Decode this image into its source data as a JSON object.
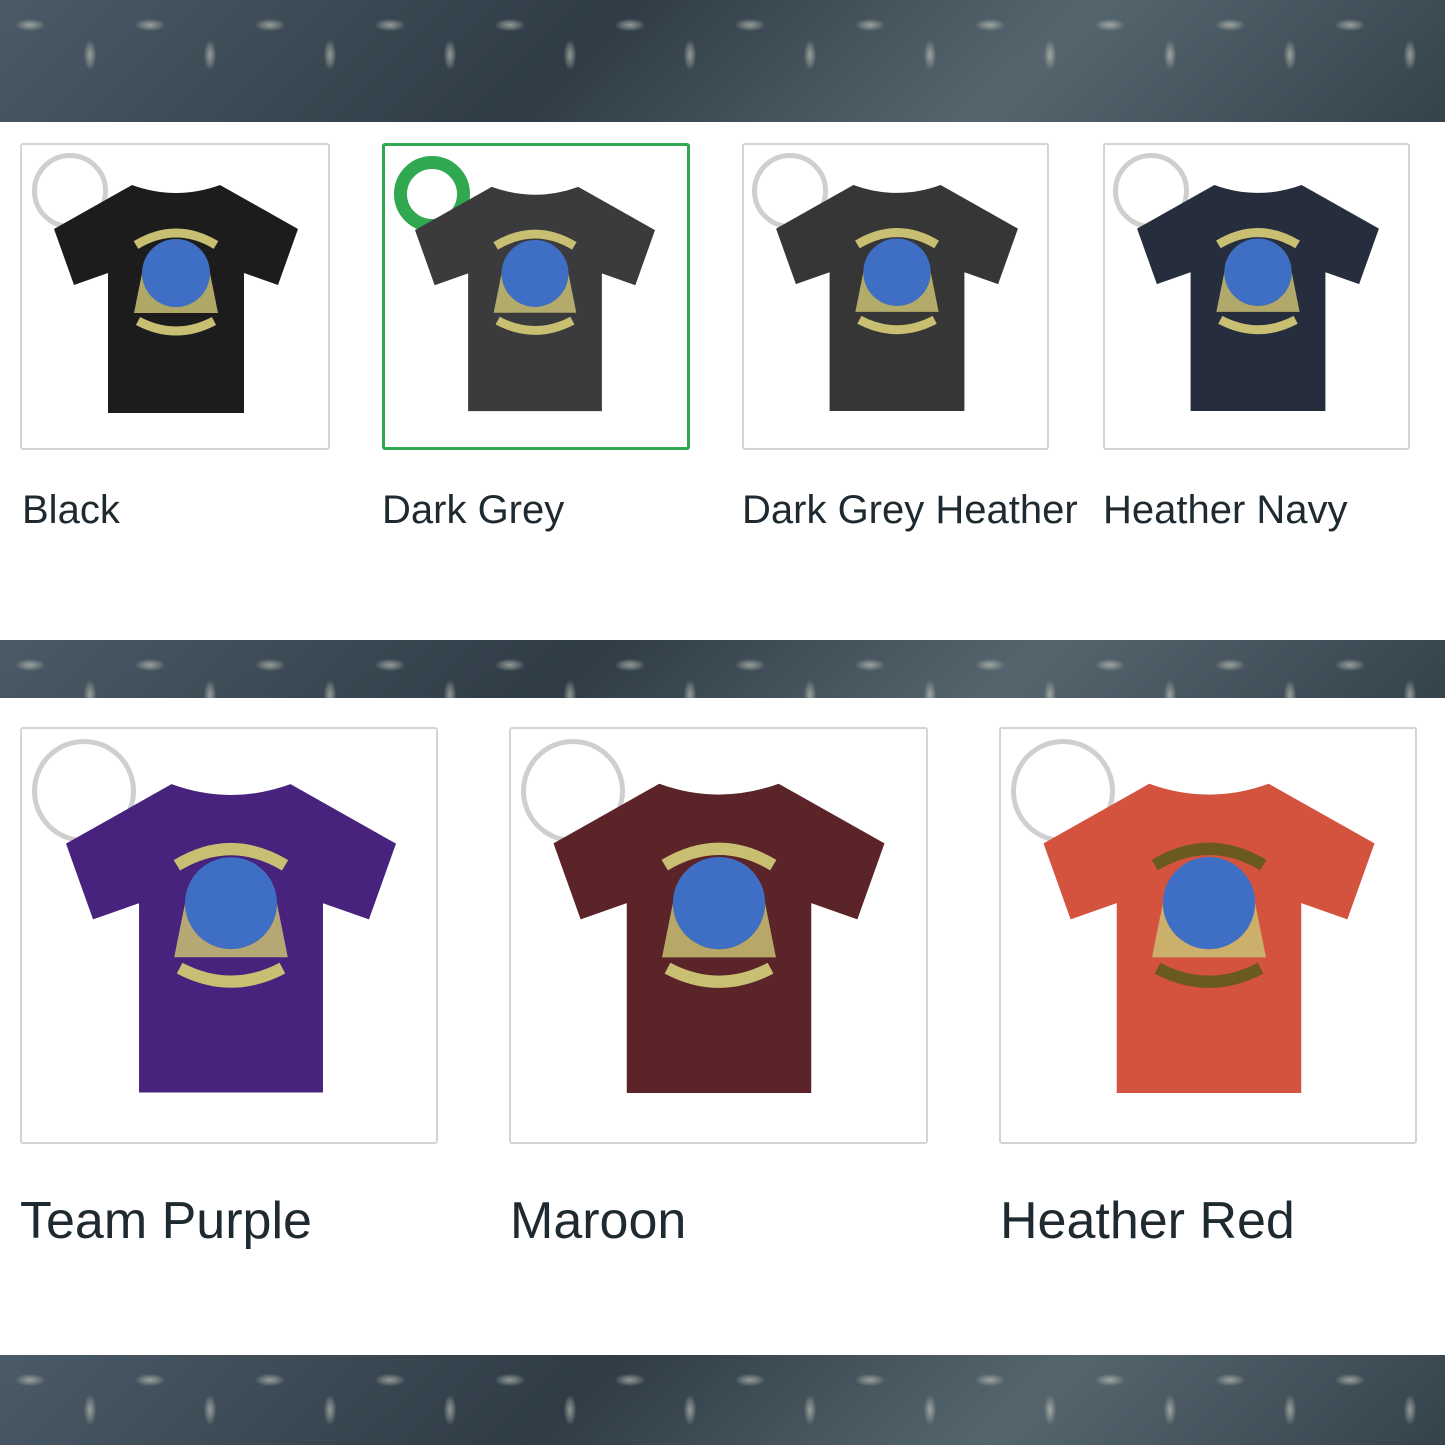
{
  "swatches_row1": [
    {
      "label": "Black",
      "shirt_color": "#1c1c1c",
      "selected": false
    },
    {
      "label": "Dark Grey",
      "shirt_color": "#3b3b3d",
      "selected": true
    },
    {
      "label": "Dark Grey Heather",
      "shirt_color": "#363636",
      "selected": false
    },
    {
      "label": "Heather Navy",
      "shirt_color": "#262d3d",
      "selected": false
    }
  ],
  "swatches_row2": [
    {
      "label": "Team Purple",
      "shirt_color": "#47237e",
      "selected": false
    },
    {
      "label": "Maroon",
      "shirt_color": "#5a2428",
      "selected": false
    },
    {
      "label": "Heather Red",
      "shirt_color": "#d4533f",
      "selected": false
    }
  ],
  "colors": {
    "selected_accent": "#2fa84f",
    "print_gold": "#c9bf73",
    "print_globe": "#3f6fc4"
  },
  "icons": {
    "radio": "radio-button-icon",
    "shirt": "t-shirt-icon",
    "texture": "diamond-plate-texture"
  }
}
